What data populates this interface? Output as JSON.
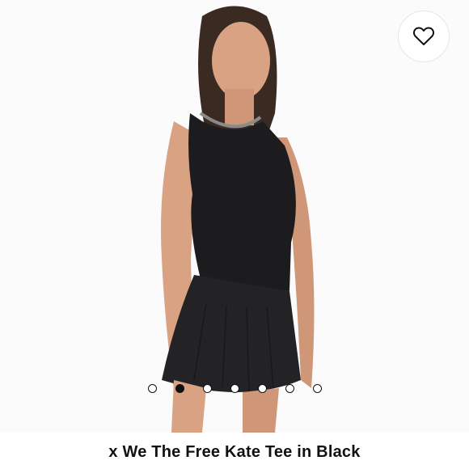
{
  "product": {
    "title": "x We The Free Kate Tee in Black",
    "image_alt": "model wearing black sleeveless top and black pleated mini skirt"
  },
  "wishlist": {
    "icon": "heart-icon"
  },
  "carousel": {
    "slide_count": 7,
    "active_index": 1
  },
  "colors": {
    "garment": "#1c1c1e",
    "skin": "#d9a283",
    "hair": "#3a2a22",
    "accent": "#111111"
  }
}
